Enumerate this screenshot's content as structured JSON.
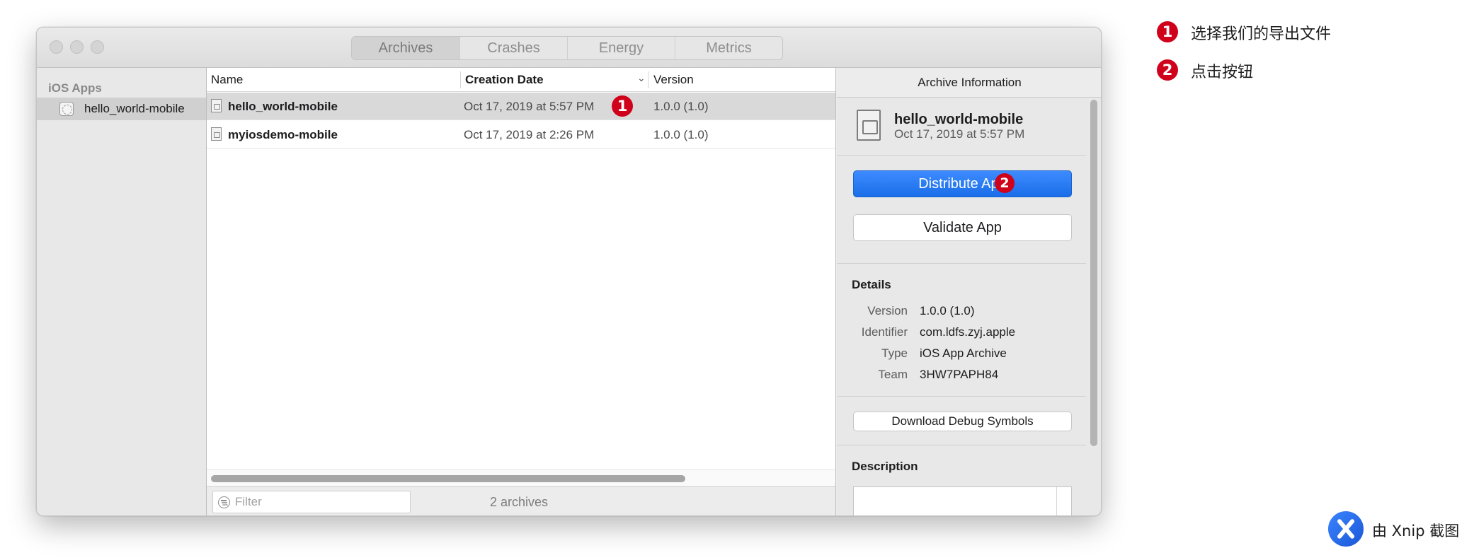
{
  "window": {
    "tabs": [
      {
        "label": "Archives",
        "active": true
      },
      {
        "label": "Crashes",
        "active": false
      },
      {
        "label": "Energy",
        "active": false
      },
      {
        "label": "Metrics",
        "active": false
      }
    ]
  },
  "sidebar": {
    "group_label": "iOS Apps",
    "items": [
      {
        "label": "hello_world-mobile",
        "icon": "app-icon",
        "selected": true
      }
    ]
  },
  "list": {
    "columns": [
      "Name",
      "Creation Date",
      "Version"
    ],
    "sorted_column": "Creation Date",
    "rows": [
      {
        "name": "hello_world-mobile",
        "date": "Oct 17, 2019 at 5:57 PM",
        "version": "1.0.0 (1.0)",
        "selected": true
      },
      {
        "name": "myiosdemo-mobile",
        "date": "Oct 17, 2019 at 2:26 PM",
        "version": "1.0.0 (1.0)",
        "selected": false
      }
    ],
    "filter_placeholder": "Filter",
    "archive_count": "2 archives"
  },
  "inspector": {
    "title": "Archive Information",
    "archive_name": "hello_world-mobile",
    "archive_date": "Oct 17, 2019 at 5:57 PM",
    "distribute_label": "Distribute App",
    "validate_label": "Validate App",
    "details_title": "Details",
    "details": [
      {
        "key": "Version",
        "value": "1.0.0 (1.0)"
      },
      {
        "key": "Identifier",
        "value": "com.ldfs.zyj.apple"
      },
      {
        "key": "Type",
        "value": "iOS App Archive"
      },
      {
        "key": "Team",
        "value": "3HW7PAPH84"
      }
    ],
    "download_symbols_label": "Download Debug Symbols",
    "description_title": "Description"
  },
  "annotations": {
    "step1_number": "1",
    "step1_text": "选择我们的导出文件",
    "step2_number": "2",
    "step2_text": "点击按钮"
  },
  "watermark": {
    "text": "由 Xnip 截图"
  },
  "colors": {
    "accent_blue": "#1a6ee8",
    "badge_red": "#d0021b",
    "selection_gray": "#d9d9d9"
  }
}
